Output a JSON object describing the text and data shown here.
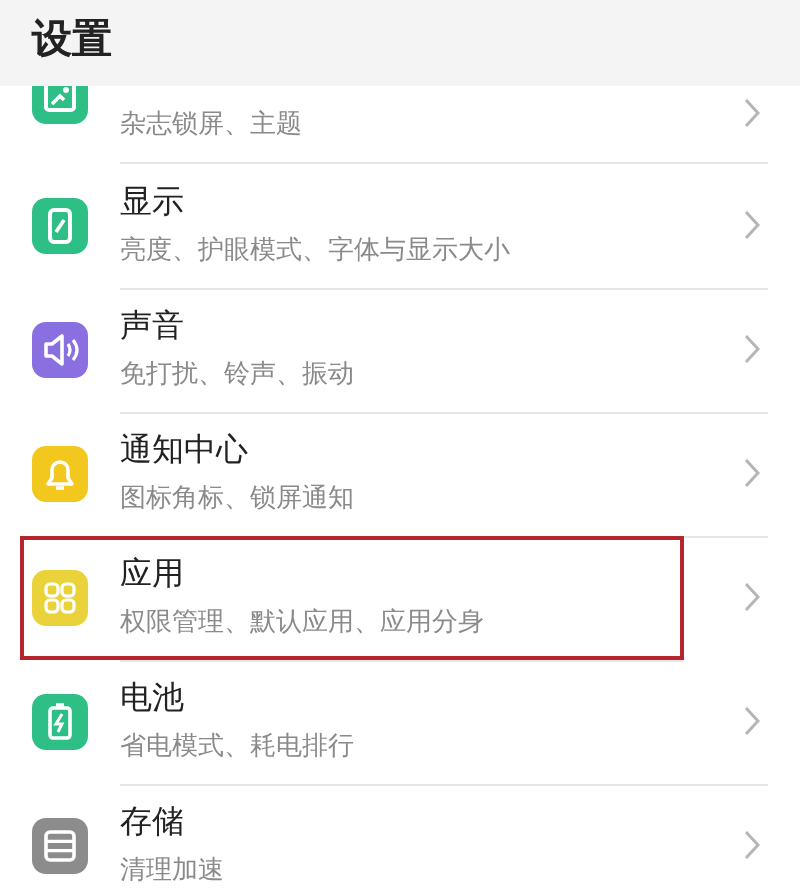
{
  "header": {
    "title": "设置"
  },
  "items": [
    {
      "subtitle": "杂志锁屏、主题",
      "color": "#2dbf86",
      "highlighted": false
    },
    {
      "title": "显示",
      "subtitle": "亮度、护眼模式、字体与显示大小",
      "color": "#2dbf86",
      "highlighted": false
    },
    {
      "title": "声音",
      "subtitle": "免打扰、铃声、振动",
      "color": "#8a6fe0",
      "highlighted": false
    },
    {
      "title": "通知中心",
      "subtitle": "图标角标、锁屏通知",
      "color": "#f2c81f",
      "highlighted": false
    },
    {
      "title": "应用",
      "subtitle": "权限管理、默认应用、应用分身",
      "color": "#ead33a",
      "highlighted": true
    },
    {
      "title": "电池",
      "subtitle": "省电模式、耗电排行",
      "color": "#2dbf86",
      "highlighted": false
    },
    {
      "title": "存储",
      "subtitle": "清理加速",
      "color": "#8c8c8c",
      "highlighted": false
    }
  ]
}
